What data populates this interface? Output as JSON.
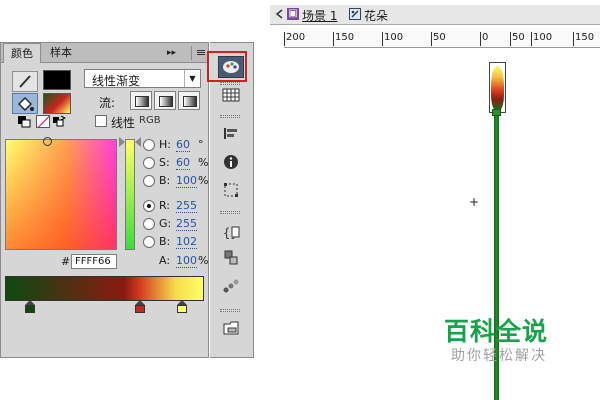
{
  "colors": {
    "accent_highlight": "#d51f1f",
    "stem_green": "#2c8a2e",
    "watermark_green": "#16a34a"
  },
  "color_panel": {
    "tabs": [
      "颜色",
      "样本"
    ],
    "collapse_glyph": "▸▸",
    "type": "线性渐变",
    "flow_label": "流:",
    "linear_label": "线性",
    "linear_extra": "RGB",
    "fields": {
      "h": {
        "label": "H:",
        "value": "60",
        "unit": "°"
      },
      "s": {
        "label": "S:",
        "value": "60",
        "unit": "%"
      },
      "b": {
        "label": "B:",
        "value": "100",
        "unit": "%"
      },
      "r": {
        "label": "R:",
        "value": "255"
      },
      "g": {
        "label": "G:",
        "value": "255"
      },
      "b2": {
        "label": "B:",
        "value": "102"
      },
      "a": {
        "label": "A:",
        "value": "100",
        "unit": "%"
      }
    },
    "hex_hash": "#",
    "hex_value": "FFFF66",
    "gradient_stops": [
      "#0d4a10",
      "#c62a1f",
      "#ffff66"
    ]
  },
  "toolbar_icons": [
    "color-wheel",
    "swatches-grid",
    "align",
    "info",
    "transform",
    "code",
    "components",
    "motion-presets",
    "library"
  ],
  "stage": {
    "breadcrumb_scene": "场景 1",
    "breadcrumb_symbol": "花朵",
    "ruler_ticks": [
      "200",
      "150",
      "100",
      "50",
      "0",
      "50",
      "100",
      "150"
    ],
    "reg_mark": "+"
  },
  "watermark": {
    "title": "百科全说",
    "subtitle": "助你轻松解决"
  }
}
